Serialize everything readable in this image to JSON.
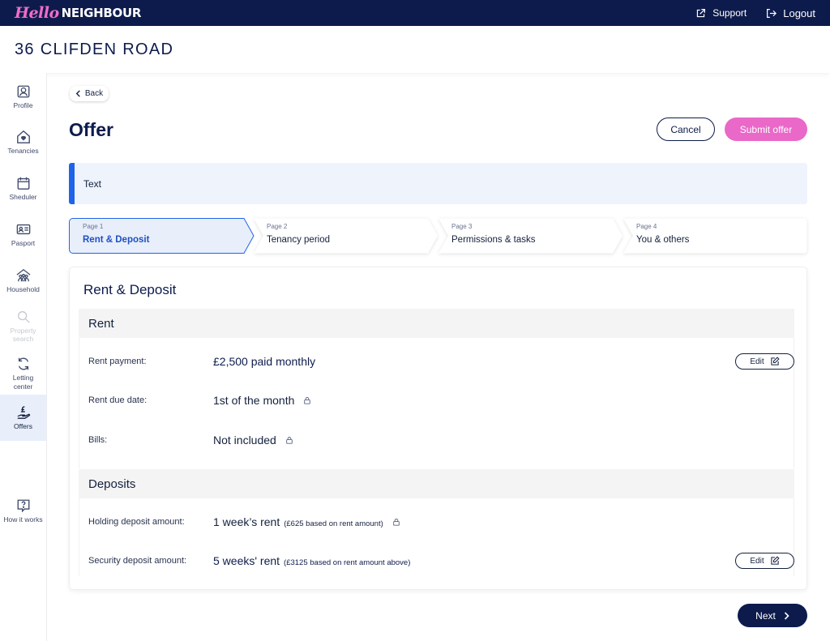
{
  "brand": {
    "hello": "Hello",
    "neighbour": "NEIGHBOUR"
  },
  "topbar": {
    "support": "Support",
    "logout": "Logout"
  },
  "property_title": "36 CLIFDEN ROAD",
  "sidebar": {
    "profile": "Profile",
    "tenancies": "Tenancies",
    "scheduler": "Sheduler",
    "passport": "Pasport",
    "household": "Household",
    "property_search_1": "Property",
    "property_search_2": "search",
    "letting_1": "Letting",
    "letting_2": "center",
    "offers": "Offers",
    "how_it_works": "How it works"
  },
  "page": {
    "back": "Back",
    "title": "Offer",
    "cancel": "Cancel",
    "submit": "Submit offer",
    "banner": "Text",
    "next": "Next"
  },
  "steps": [
    {
      "page": "Page 1",
      "label": "Rent & Deposit",
      "active": true
    },
    {
      "page": "Page 2",
      "label": "Tenancy period",
      "active": false
    },
    {
      "page": "Page 3",
      "label": "Permissions & tasks",
      "active": false
    },
    {
      "page": "Page 4",
      "label": "You & others",
      "active": false
    }
  ],
  "card": {
    "title": "Rent & Deposit",
    "rent_section": "Rent",
    "deposits_section": "Deposits",
    "edit_label": "Edit",
    "rows": {
      "rent_payment": {
        "label": "Rent payment:",
        "value": "£2,500 paid monthly"
      },
      "rent_due": {
        "label": "Rent due date:",
        "value": "1st of the month"
      },
      "bills": {
        "label": "Bills:",
        "value": "Not included"
      },
      "holding": {
        "label": "Holding deposit amount:",
        "value": "1 week’s rent",
        "note": "(£625 based on rent amount)"
      },
      "security": {
        "label": "Security deposit amount:",
        "value": "5 weeks' rent",
        "note": "(£3125 based on rent amount above)"
      }
    }
  },
  "colors": {
    "navy": "#0d1b4c",
    "pink": "#e968c8",
    "accent_blue": "#1f64e8",
    "active_bg": "#e8effb"
  }
}
